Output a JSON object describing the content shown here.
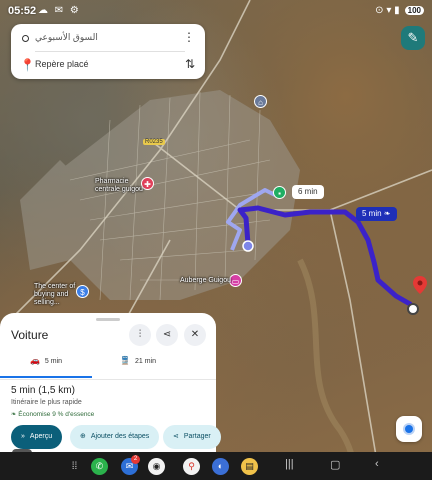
{
  "status_bar": {
    "time": "05:52",
    "left_icons": "☁ ✉ ⚙",
    "right_icons": "⊙ ▾ ▮",
    "battery": "100"
  },
  "route_card": {
    "origin": "السوق الأسبوعي",
    "destination": "Repère placé",
    "more_icon": "more-vert-icon",
    "swap_icon": "swap-icon"
  },
  "map": {
    "alt_route_time": "6 min",
    "main_route_time": "5 min",
    "road_label": "R0235",
    "labels": {
      "pharmacy": "Pharmacie centrale guigou",
      "center": "The center of buying and selling...",
      "auberge": "Auberge Guigou"
    },
    "colors": {
      "main_route": "#3b22c8",
      "alt_route": "#9fa7f0"
    }
  },
  "sheet": {
    "title": "Voiture",
    "tabs": [
      {
        "label": "5 min",
        "icon": "car-icon"
      },
      {
        "label": "21 min",
        "icon": "transit-icon"
      }
    ],
    "duration": "5 min (1,5 km)",
    "subtitle": "Itinéraire le plus rapide",
    "eco": "Économise 9 % d'essence"
  },
  "actions": {
    "overview": "Aperçu",
    "add_steps": "Ajouter des étapes",
    "share": "Partager"
  },
  "nav": {
    "msg_badge": "2"
  }
}
